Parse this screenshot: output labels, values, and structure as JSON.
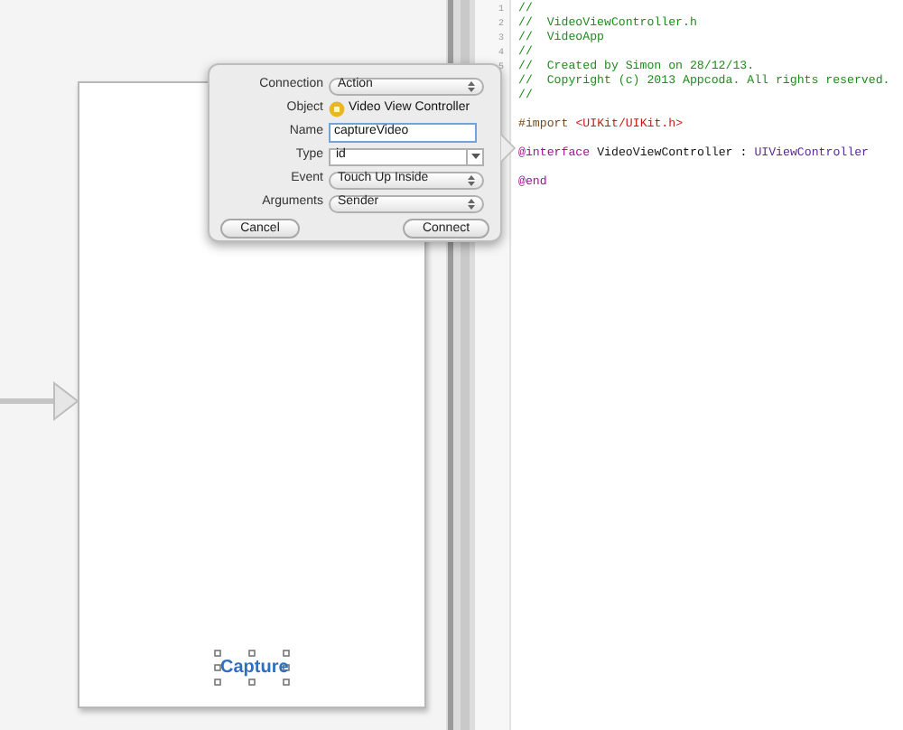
{
  "popover": {
    "rows": [
      {
        "label": "Connection",
        "kind": "popup",
        "value": "Action"
      },
      {
        "label": "Object",
        "kind": "object",
        "value": "Video View Controller"
      },
      {
        "label": "Name",
        "kind": "text",
        "value": "captureVideo"
      },
      {
        "label": "Type",
        "kind": "combo",
        "value": "id"
      },
      {
        "label": "Event",
        "kind": "popup",
        "value": "Touch Up Inside"
      },
      {
        "label": "Arguments",
        "kind": "popup",
        "value": "Sender"
      }
    ],
    "buttons": [
      "Cancel",
      "Connect"
    ]
  },
  "canvas": {
    "button_label": "Capture"
  },
  "editor": {
    "lines": [
      {
        "number": "1",
        "segments": [
          {
            "kind": "comment",
            "text": "//"
          }
        ]
      },
      {
        "number": "2",
        "segments": [
          {
            "kind": "comment",
            "text": "//  VideoViewController.h"
          }
        ]
      },
      {
        "number": "3",
        "segments": [
          {
            "kind": "comment",
            "text": "//  VideoApp"
          }
        ]
      },
      {
        "number": "4",
        "segments": [
          {
            "kind": "comment",
            "text": "//"
          }
        ]
      },
      {
        "number": "5",
        "segments": [
          {
            "kind": "comment",
            "text": "//  Created by Simon on 28/12/13."
          }
        ]
      },
      {
        "segments": [
          {
            "kind": "comment",
            "text": "//  Copyright (c) 2013 Appcoda. All rights reserved."
          }
        ]
      },
      {
        "segments": [
          {
            "kind": "comment",
            "text": "//"
          }
        ]
      },
      {
        "blank_line_before": true,
        "segments": [
          {
            "kind": "directive",
            "text": "#import"
          },
          {
            "kind": "string",
            "text": "<UIKit/UIKit.h>"
          }
        ]
      },
      {
        "blank_line_before": true,
        "segments": [
          {
            "kind": "keyword",
            "text": "@interface"
          },
          {
            "kind": "plain",
            "text": "VideoViewController :"
          },
          {
            "kind": "type",
            "text": "UIViewController"
          }
        ]
      },
      {
        "blank_line_before": true,
        "segments": [
          {
            "kind": "keyword",
            "text": "@end"
          }
        ]
      }
    ]
  }
}
